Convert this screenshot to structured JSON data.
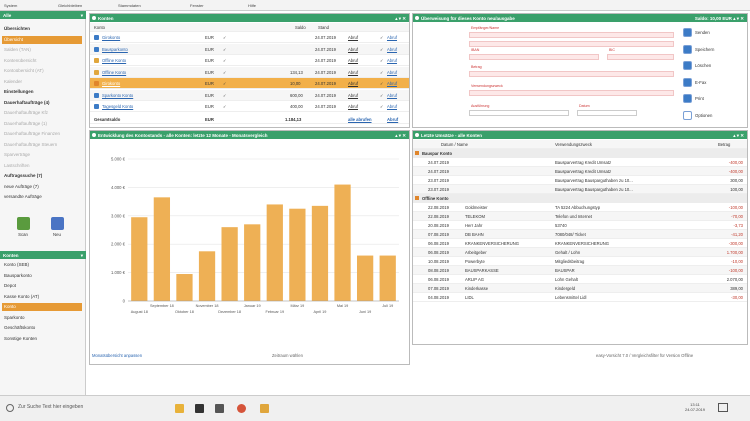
{
  "menubar": {
    "items": [
      "System",
      "Gleichbleiben",
      "Stammdaten",
      "Fenster",
      "Hilfe"
    ]
  },
  "sidebar": {
    "header": "Alle",
    "items": [
      {
        "label": "Übersichten",
        "style": "bold"
      },
      {
        "label": "Übersicht",
        "style": "sel"
      },
      {
        "label": "Salden (TAN)",
        "style": "fade"
      },
      {
        "label": "Kontenübersicht",
        "style": "fade"
      },
      {
        "label": "Kontoübersicht (AT)",
        "style": "fade"
      },
      {
        "label": "Kalender",
        "style": "fade"
      },
      {
        "label": "Einstellungen",
        "style": "bold"
      },
      {
        "label": "Dauerhaftaufträge (4)",
        "style": "bold"
      },
      {
        "label": "Dauerhaftaufträge Kfz",
        "style": "fade"
      },
      {
        "label": "Dauerhaftaufträge (1)",
        "style": "fade"
      },
      {
        "label": "Dauerhaftaufträge Finanzen",
        "style": "fade"
      },
      {
        "label": "Dauerhaftaufträge Steuern",
        "style": "fade"
      },
      {
        "label": "Sparverträge",
        "style": "fade"
      },
      {
        "label": "Lastschriften",
        "style": "fade"
      },
      {
        "label": "Auftragssuche (7)",
        "style": "bold"
      },
      {
        "label": "neue Aufträge (7)",
        "style": ""
      },
      {
        "label": "versandte Aufträge",
        "style": ""
      }
    ],
    "tools": [
      {
        "label": "Scan"
      },
      {
        "label": "Neu"
      }
    ],
    "accounts_header": "Konten",
    "accounts": [
      {
        "label": "Konto (SEB)",
        "style": ""
      },
      {
        "label": "Bauspar­konto",
        "style": ""
      },
      {
        "label": "Depot",
        "style": ""
      },
      {
        "label": "Kasse Konto (AT)",
        "style": ""
      },
      {
        "label": "Konto",
        "style": "sel"
      },
      {
        "label": "Sparkonto",
        "style": ""
      },
      {
        "label": "Geschäftskonto",
        "style": ""
      },
      {
        "label": "Sonstige Konten",
        "style": ""
      }
    ]
  },
  "accounts_panel": {
    "title": "Konten",
    "header": {
      "name": "Konto",
      "saldo": "Saldo",
      "stand": "Stand"
    },
    "rows": [
      {
        "name": "Girokonto",
        "cur": "EUR",
        "saldo": "",
        "date": "24.07.2019",
        "action": "Abruf",
        "icon": "#3c7bc6",
        "sel": false
      },
      {
        "name": "Bauspar­konto",
        "cur": "EUR",
        "saldo": "",
        "date": "24.07.2019",
        "action": "Abruf",
        "icon": "#3c7bc6",
        "sel": false
      },
      {
        "name": "Offline Konto",
        "cur": "EUR",
        "saldo": "",
        "date": "24.07.2019",
        "action": "Abruf",
        "icon": "#e0a63c",
        "sel": false
      },
      {
        "name": "Offline Konto",
        "cur": "EUR",
        "saldo": "134,13",
        "date": "24.07.2019",
        "action": "Abruf",
        "icon": "#e0a63c",
        "sel": false
      },
      {
        "name": "Girokonto",
        "cur": "EUR",
        "saldo": "10,00",
        "date": "24.07.2019",
        "action": "Abruf",
        "icon": "#e0862c",
        "sel": true
      },
      {
        "name": "Sparkonto Konto",
        "cur": "EUR",
        "saldo": "600,00",
        "date": "24.07.2019",
        "action": "Abruf",
        "icon": "#3c7bc6",
        "sel": false
      },
      {
        "name": "Tagesgeld Konto",
        "cur": "EUR",
        "saldo": "400,00",
        "date": "24.07.2019",
        "action": "Abruf",
        "icon": "#3c7bc6",
        "sel": false
      }
    ],
    "total": {
      "label": "Gesamtsaldo",
      "cur": "EUR",
      "saldo": "1.184,13",
      "action": "alle abrufen",
      "action2": "Abruf"
    }
  },
  "transfer_panel": {
    "title": "Überweisung für dieses Konto neu/ausgabe",
    "meta": "Saldo: 10,00 EUR",
    "fields": {
      "empf": "Empfänger/Name",
      "iban": "IBAN",
      "bic": "BIC",
      "betrag": "Betrag",
      "verwendung": "Verwendungszweck",
      "ausf": "Ausführung",
      "datum": "Datum"
    },
    "actions": [
      {
        "label": "Senden",
        "color": "#3c7bc6"
      },
      {
        "label": "Speichern",
        "color": "#3c7bc6"
      },
      {
        "label": "Löschen",
        "color": "#3c7bc6"
      },
      {
        "label": "E-Fax",
        "color": "#3c7bc6"
      },
      {
        "label": "Print",
        "color": "#3c7bc6"
      },
      {
        "label": "Optionen",
        "color": "#ffffff"
      }
    ]
  },
  "chart_panel": {
    "title": "Entwicklung des Kontostands - alle Konten: letzte 12 Monate - Monatsvergleich",
    "footer_link": "Monatsübersicht anpassen",
    "footer_mid": "Zeitraum wählen",
    "footer_right": "easy-Vorsicht 7.0 / Vergleichsfilter für Version Offline"
  },
  "chart_data": {
    "type": "bar",
    "categories": [
      "Aug 18",
      "Sep 18",
      "Okt 18",
      "Nov 18",
      "Dez 18",
      "Jan 19",
      "Feb 19",
      "Mär 19",
      "Apr 19",
      "Mai 19",
      "Jun 19",
      "Jul 19"
    ],
    "x_tick_labels_top": [
      "September 18",
      "November 18",
      "Januar 19",
      "März 19",
      "Mai 19",
      "Juli 19"
    ],
    "x_tick_labels_bottom": [
      "August 18",
      "Oktober 18",
      "Dezember 18",
      "Februar 19",
      "April 19",
      "Juni 19"
    ],
    "values": [
      2950,
      3650,
      950,
      1750,
      2600,
      2700,
      3400,
      3250,
      3350,
      4100,
      1600,
      1600
    ],
    "ylim": [
      0,
      5000
    ],
    "yticks": [
      "0",
      "1.000 €",
      "2.000 €",
      "3.000 €",
      "4.000 €",
      "5.000 €"
    ],
    "color": "#eeb055",
    "grid": true
  },
  "transactions_panel": {
    "title": "Letzte Umsätze - alle Konten",
    "header": {
      "date": "Datum / Name",
      "purpose": "Verwendungszweck",
      "amount": "Betrag"
    },
    "groups": [
      {
        "name": "Bauspar Konto",
        "rows": [
          {
            "date": "24.07.2019",
            "name": "",
            "purpose": "Bausparvertrag Kredit Umsatz",
            "amount": "-400,00",
            "neg": true
          },
          {
            "date": "24.07.2019",
            "name": "",
            "purpose": "Bausparvertrag Kredit Umsatz",
            "amount": "-400,00",
            "neg": true
          },
          {
            "date": "23.07.2019",
            "name": "",
            "purpose": "Bausparvertrag Bausparguthaben zu 10...",
            "amount": "300,00",
            "neg": false
          },
          {
            "date": "23.07.2019",
            "name": "",
            "purpose": "Bausparvertrag Bausparguthaben zu 10...",
            "amount": "100,00",
            "neg": false
          }
        ]
      },
      {
        "name": "Offline Konto",
        "rows": [
          {
            "date": "22.08.2019",
            "name": "Goldmeister",
            "purpose": "TA 5224 Abbuchungstyp",
            "amount": "-100,00",
            "neg": true
          },
          {
            "date": "22.08.2019",
            "name": "TELEKOM",
            "purpose": "Telefon und Internet",
            "amount": "-70,00",
            "neg": true
          },
          {
            "date": "20.08.2019",
            "name": "Herr Jahr",
            "purpose": "53740",
            "amount": "-3,73",
            "neg": true
          },
          {
            "date": "07.08.2019",
            "name": "DB BAHN",
            "purpose": "7080/048/ Ticket",
            "amount": "-41,20",
            "neg": true
          },
          {
            "date": "06.08.2019",
            "name": "KRANKENVERSICHERUNG",
            "purpose": "KRANKENVERSICHERUNG",
            "amount": "-300,00",
            "neg": true
          },
          {
            "date": "06.08.2019",
            "name": "Arbeitgeber",
            "purpose": "Gehalt / Lohn",
            "amount": "1.700,00",
            "neg": true
          },
          {
            "date": "10.08.2019",
            "name": "Powerbyte",
            "purpose": "Mitgliedsbeitrag",
            "amount": "-10,00",
            "neg": true
          },
          {
            "date": "08.08.2019",
            "name": "BAUSPARKASSE",
            "purpose": "BAUSPAR",
            "amount": "-100,00",
            "neg": true
          },
          {
            "date": "06.08.2019",
            "name": "ARLIP AG",
            "purpose": "Lohn Gehalt",
            "amount": "2.070,00",
            "neg": false
          },
          {
            "date": "07.08.2019",
            "name": "Kinderkasse",
            "purpose": "Kindergeld",
            "amount": "389,00",
            "neg": false
          },
          {
            "date": "04.08.2019",
            "name": "LIDL",
            "purpose": "Lebensmittel Lidl",
            "amount": "-30,00",
            "neg": true
          }
        ]
      }
    ]
  },
  "taskbar": {
    "search_placeholder": "Zur Suche Text hier eingeben",
    "time": "13:11",
    "date": "24.07.2019"
  },
  "colors": {
    "accent": "#3aa06b",
    "selection": "#f2b04a",
    "bar": "#eeb055",
    "negative": "#c0392b"
  }
}
